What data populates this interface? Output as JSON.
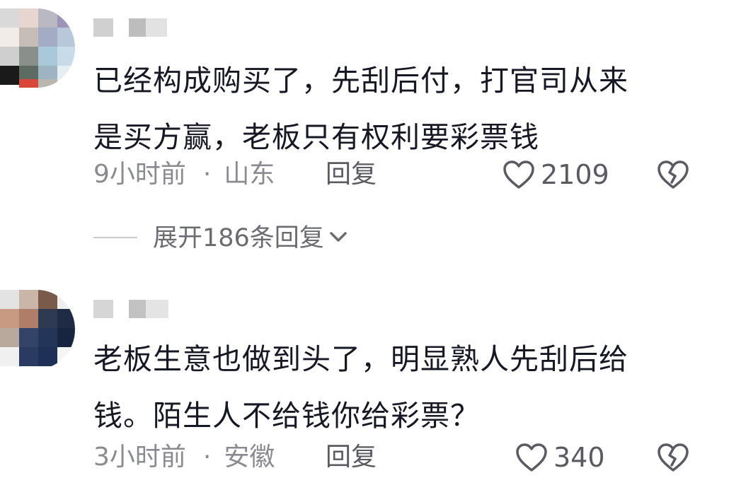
{
  "comments": [
    {
      "text": "已经构成购买了，先刮后付，打官司从来\n是买方赢，老板只有权利要彩票钱",
      "time": "9小时前",
      "separator": "·",
      "location": "山东",
      "reply_label": "回复",
      "like_count": "2109",
      "expand_label": "展开186条回复"
    },
    {
      "text": "老板生意也做到头了，明显熟人先刮后给\n钱。陌生人不给钱你给彩票？",
      "time": "3小时前",
      "separator": "·",
      "location": "安徽",
      "reply_label": "回复",
      "like_count": "340"
    }
  ],
  "icons": {
    "like": "heart-outline-icon",
    "dislike": "broken-heart-icon",
    "expand": "chevron-down-icon"
  },
  "colors": {
    "text": "#161823",
    "meta": "#8a8b91",
    "icon": "#5a5b62"
  }
}
